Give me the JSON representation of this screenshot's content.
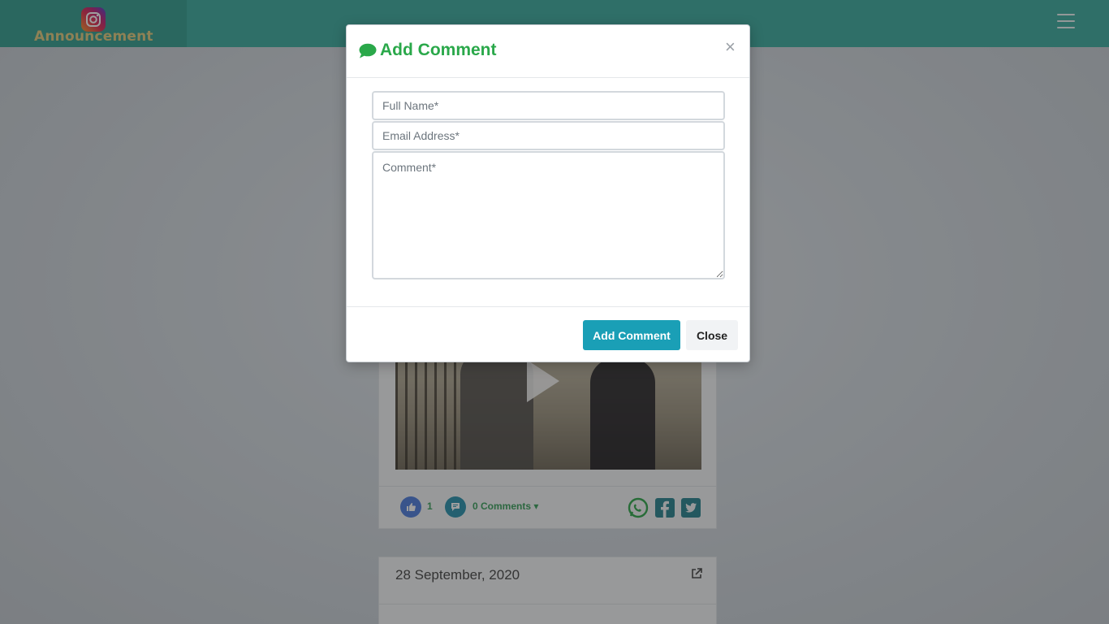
{
  "navbar": {
    "brand_text": "Announcement",
    "brand_icon": "instagram-icon",
    "menu_icon": "hamburger-menu-icon"
  },
  "post": {
    "like_count": "1",
    "comments_label": "0 Comments",
    "comments_caret": "▾",
    "share_icons": [
      "whatsapp-icon",
      "facebook-icon",
      "twitter-icon"
    ]
  },
  "next_post": {
    "date": "28 September, 2020",
    "link_icon": "external-link-icon"
  },
  "modal": {
    "title": "Add Comment",
    "title_icon": "comment-icon",
    "close_symbol": "×",
    "fields": {
      "name_placeholder": "Full Name*",
      "email_placeholder": "Email Address*",
      "comment_placeholder": "Comment*"
    },
    "buttons": {
      "submit_label": "Add Comment",
      "close_label": "Close"
    }
  },
  "colors": {
    "navbar": "#4db3a8",
    "brand_text": "#e6d08a",
    "title_green": "#2aa84a",
    "submit_button": "#1a9fb6"
  }
}
